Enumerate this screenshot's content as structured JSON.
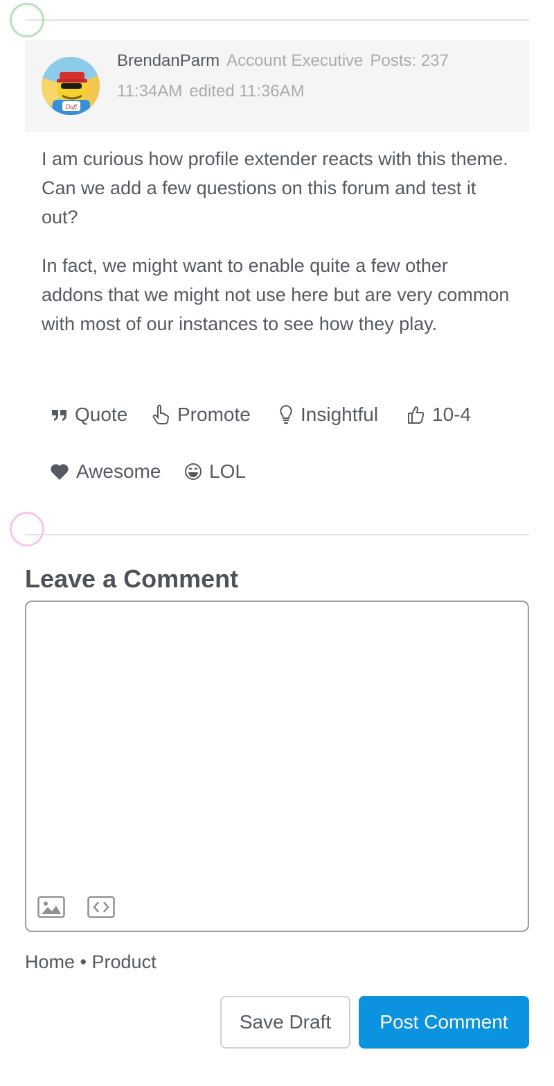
{
  "post": {
    "author": "BrendanParm",
    "role": "Account Executive",
    "posts": "Posts: 237",
    "time": "11:34AM",
    "edited": "edited 11:36AM",
    "paragraphs": [
      "I am curious how profile extender reacts with this theme. Can we add a few questions on this forum and test it out?",
      "In fact, we might want to enable quite a few other addons that we might not use here but are very common with most of our instances to see how they play."
    ]
  },
  "reactions": [
    {
      "label": "Quote",
      "icon": "quote-icon"
    },
    {
      "label": "Promote",
      "icon": "pointing-hand-icon"
    },
    {
      "label": "Insightful",
      "icon": "lightbulb-icon"
    },
    {
      "label": "10-4",
      "icon": "thumbs-up-icon"
    },
    {
      "label": "Awesome",
      "icon": "heart-icon"
    },
    {
      "label": "LOL",
      "icon": "laughing-face-icon"
    }
  ],
  "comment": {
    "title": "Leave a Comment",
    "body": "",
    "tools": [
      {
        "icon": "image-icon"
      },
      {
        "icon": "code-icon"
      }
    ]
  },
  "breadcrumb": {
    "home": "Home",
    "separator": "•",
    "product": "Product"
  },
  "buttons": {
    "save_draft": "Save Draft",
    "post_comment": "Post Comment"
  },
  "colors": {
    "accent": "#0b93e0",
    "text": "#555a62",
    "muted": "#a8acb0",
    "header_bg": "#f5f5f5"
  }
}
